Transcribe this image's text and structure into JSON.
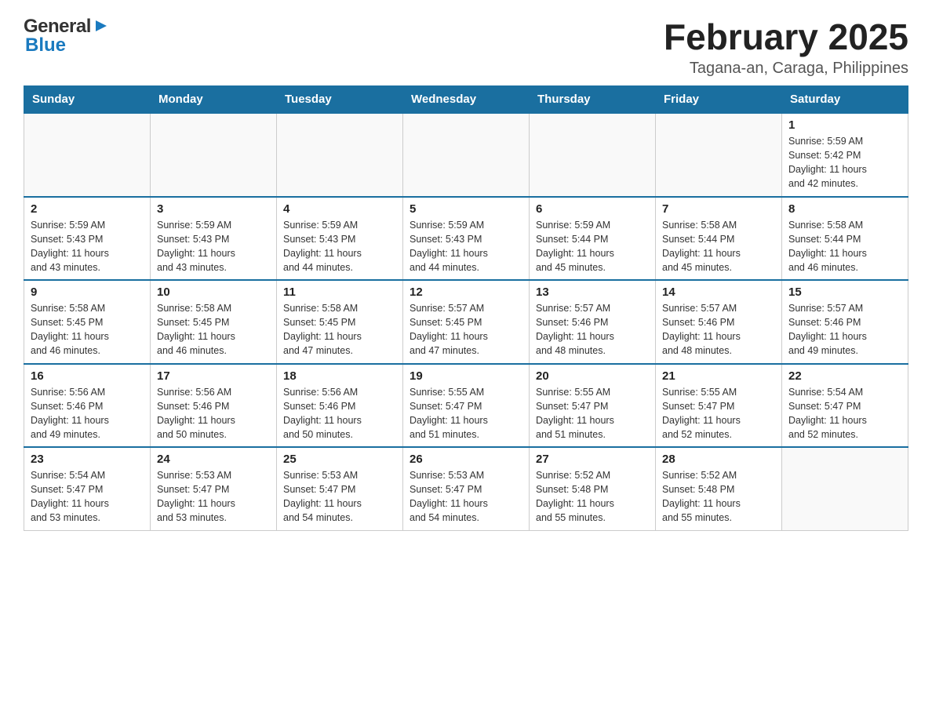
{
  "logo": {
    "general": "General",
    "blue": "Blue"
  },
  "header": {
    "month_title": "February 2025",
    "location": "Tagana-an, Caraga, Philippines"
  },
  "days_of_week": [
    "Sunday",
    "Monday",
    "Tuesday",
    "Wednesday",
    "Thursday",
    "Friday",
    "Saturday"
  ],
  "weeks": [
    {
      "cells": [
        {
          "day": "",
          "info": ""
        },
        {
          "day": "",
          "info": ""
        },
        {
          "day": "",
          "info": ""
        },
        {
          "day": "",
          "info": ""
        },
        {
          "day": "",
          "info": ""
        },
        {
          "day": "",
          "info": ""
        },
        {
          "day": "1",
          "info": "Sunrise: 5:59 AM\nSunset: 5:42 PM\nDaylight: 11 hours\nand 42 minutes."
        }
      ]
    },
    {
      "cells": [
        {
          "day": "2",
          "info": "Sunrise: 5:59 AM\nSunset: 5:43 PM\nDaylight: 11 hours\nand 43 minutes."
        },
        {
          "day": "3",
          "info": "Sunrise: 5:59 AM\nSunset: 5:43 PM\nDaylight: 11 hours\nand 43 minutes."
        },
        {
          "day": "4",
          "info": "Sunrise: 5:59 AM\nSunset: 5:43 PM\nDaylight: 11 hours\nand 44 minutes."
        },
        {
          "day": "5",
          "info": "Sunrise: 5:59 AM\nSunset: 5:43 PM\nDaylight: 11 hours\nand 44 minutes."
        },
        {
          "day": "6",
          "info": "Sunrise: 5:59 AM\nSunset: 5:44 PM\nDaylight: 11 hours\nand 45 minutes."
        },
        {
          "day": "7",
          "info": "Sunrise: 5:58 AM\nSunset: 5:44 PM\nDaylight: 11 hours\nand 45 minutes."
        },
        {
          "day": "8",
          "info": "Sunrise: 5:58 AM\nSunset: 5:44 PM\nDaylight: 11 hours\nand 46 minutes."
        }
      ]
    },
    {
      "cells": [
        {
          "day": "9",
          "info": "Sunrise: 5:58 AM\nSunset: 5:45 PM\nDaylight: 11 hours\nand 46 minutes."
        },
        {
          "day": "10",
          "info": "Sunrise: 5:58 AM\nSunset: 5:45 PM\nDaylight: 11 hours\nand 46 minutes."
        },
        {
          "day": "11",
          "info": "Sunrise: 5:58 AM\nSunset: 5:45 PM\nDaylight: 11 hours\nand 47 minutes."
        },
        {
          "day": "12",
          "info": "Sunrise: 5:57 AM\nSunset: 5:45 PM\nDaylight: 11 hours\nand 47 minutes."
        },
        {
          "day": "13",
          "info": "Sunrise: 5:57 AM\nSunset: 5:46 PM\nDaylight: 11 hours\nand 48 minutes."
        },
        {
          "day": "14",
          "info": "Sunrise: 5:57 AM\nSunset: 5:46 PM\nDaylight: 11 hours\nand 48 minutes."
        },
        {
          "day": "15",
          "info": "Sunrise: 5:57 AM\nSunset: 5:46 PM\nDaylight: 11 hours\nand 49 minutes."
        }
      ]
    },
    {
      "cells": [
        {
          "day": "16",
          "info": "Sunrise: 5:56 AM\nSunset: 5:46 PM\nDaylight: 11 hours\nand 49 minutes."
        },
        {
          "day": "17",
          "info": "Sunrise: 5:56 AM\nSunset: 5:46 PM\nDaylight: 11 hours\nand 50 minutes."
        },
        {
          "day": "18",
          "info": "Sunrise: 5:56 AM\nSunset: 5:46 PM\nDaylight: 11 hours\nand 50 minutes."
        },
        {
          "day": "19",
          "info": "Sunrise: 5:55 AM\nSunset: 5:47 PM\nDaylight: 11 hours\nand 51 minutes."
        },
        {
          "day": "20",
          "info": "Sunrise: 5:55 AM\nSunset: 5:47 PM\nDaylight: 11 hours\nand 51 minutes."
        },
        {
          "day": "21",
          "info": "Sunrise: 5:55 AM\nSunset: 5:47 PM\nDaylight: 11 hours\nand 52 minutes."
        },
        {
          "day": "22",
          "info": "Sunrise: 5:54 AM\nSunset: 5:47 PM\nDaylight: 11 hours\nand 52 minutes."
        }
      ]
    },
    {
      "cells": [
        {
          "day": "23",
          "info": "Sunrise: 5:54 AM\nSunset: 5:47 PM\nDaylight: 11 hours\nand 53 minutes."
        },
        {
          "day": "24",
          "info": "Sunrise: 5:53 AM\nSunset: 5:47 PM\nDaylight: 11 hours\nand 53 minutes."
        },
        {
          "day": "25",
          "info": "Sunrise: 5:53 AM\nSunset: 5:47 PM\nDaylight: 11 hours\nand 54 minutes."
        },
        {
          "day": "26",
          "info": "Sunrise: 5:53 AM\nSunset: 5:47 PM\nDaylight: 11 hours\nand 54 minutes."
        },
        {
          "day": "27",
          "info": "Sunrise: 5:52 AM\nSunset: 5:48 PM\nDaylight: 11 hours\nand 55 minutes."
        },
        {
          "day": "28",
          "info": "Sunrise: 5:52 AM\nSunset: 5:48 PM\nDaylight: 11 hours\nand 55 minutes."
        },
        {
          "day": "",
          "info": ""
        }
      ]
    }
  ]
}
